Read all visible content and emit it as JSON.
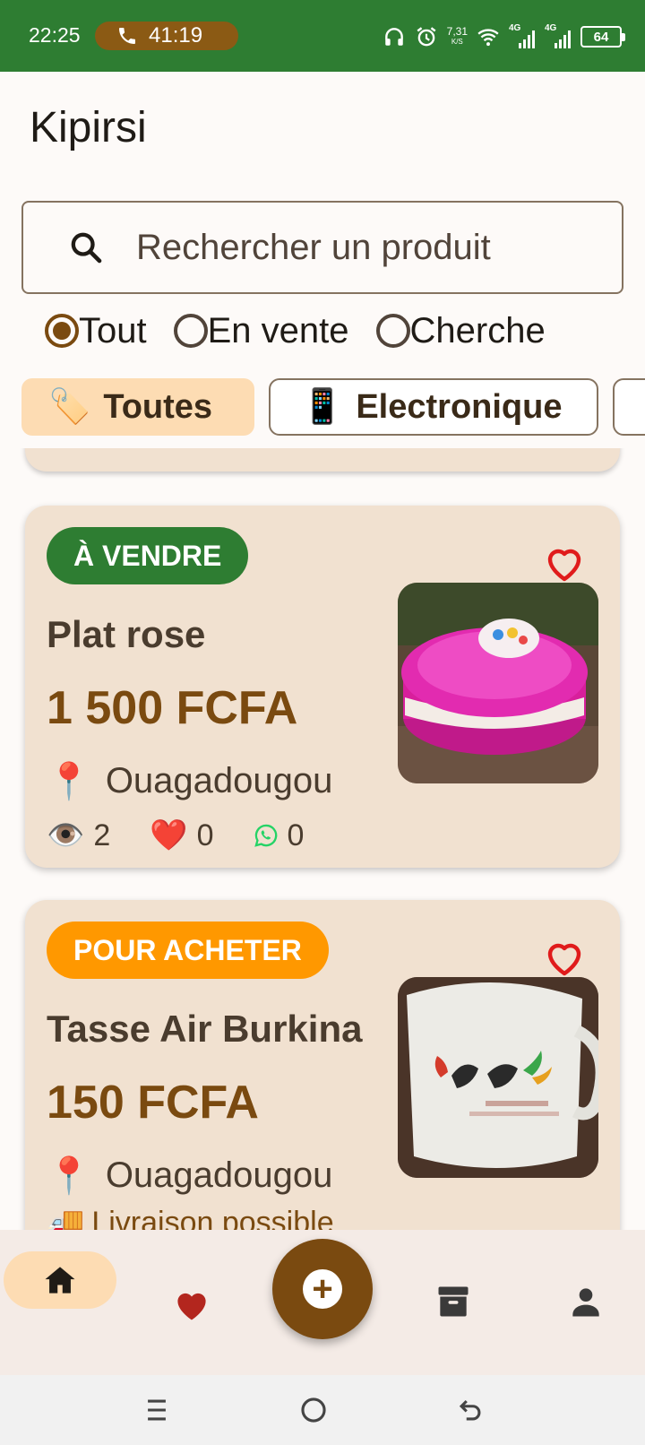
{
  "status_bar": {
    "time": "22:25",
    "call_duration": "41:19",
    "speed_value": "7,31",
    "speed_unit": "K/S",
    "net1": "4G",
    "net2": "4G",
    "battery": "64"
  },
  "app": {
    "title": "Kipirsi"
  },
  "search": {
    "placeholder": "Rechercher un produit"
  },
  "filters": {
    "radios": [
      {
        "label": "Tout",
        "checked": true
      },
      {
        "label": "En vente",
        "checked": false
      },
      {
        "label": "Cherche",
        "checked": false
      }
    ]
  },
  "categories": [
    {
      "label": "Toutes",
      "emoji": "🏷️",
      "selected": true
    },
    {
      "label": "Electronique",
      "emoji": "📱",
      "selected": false
    }
  ],
  "listings": [
    {
      "badge": "À VENDRE",
      "badge_color": "#2e7d32",
      "title": "Plat rose",
      "price": "1 500 FCFA",
      "location": "Ouagadougou",
      "views": "2",
      "likes": "0",
      "whatsapp": "0"
    },
    {
      "badge": "POUR ACHETER",
      "badge_color": "#ff9800",
      "title": "Tasse Air Burkina",
      "price": "150 FCFA",
      "location": "Ouagadougou",
      "delivery": "Livraison possible"
    }
  ],
  "colors": {
    "brand_brown": "#7a4a10",
    "status_green": "#2e7d32",
    "card_bg": "#f1e1d0",
    "chip_selected": "#fddcb3"
  },
  "bottom_nav": [
    {
      "name": "home",
      "icon": "home-icon",
      "selected": true
    },
    {
      "name": "favorites",
      "icon": "heart-icon"
    },
    {
      "name": "add",
      "icon": "plus-icon"
    },
    {
      "name": "archive",
      "icon": "archive-icon"
    },
    {
      "name": "profile",
      "icon": "person-icon"
    }
  ]
}
